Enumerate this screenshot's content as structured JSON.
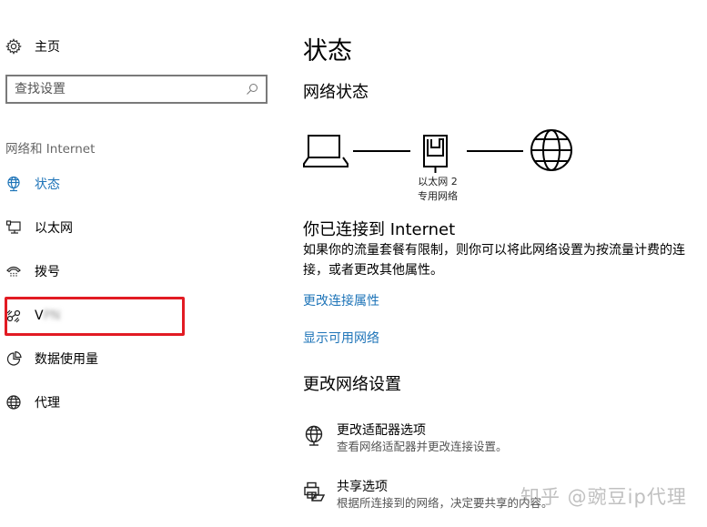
{
  "sidebar": {
    "home_label": "主页",
    "search_placeholder": "查找设置",
    "section_header": "网络和 Internet",
    "items": [
      {
        "label": "状态",
        "icon": "globe-monitor-icon",
        "active": true
      },
      {
        "label": "以太网",
        "icon": "ethernet-monitor-icon",
        "active": false
      },
      {
        "label": "拨号",
        "icon": "dialup-phone-icon",
        "active": false
      },
      {
        "label": "V",
        "label_blurred": "PN",
        "icon": "vpn-icon",
        "active": false,
        "highlighted": true
      },
      {
        "label": "数据使用量",
        "icon": "data-usage-pie-icon",
        "active": false
      },
      {
        "label": "代理",
        "icon": "globe-icon",
        "active": false
      }
    ]
  },
  "main": {
    "title": "状态",
    "network_status_heading": "网络状态",
    "diagram": {
      "adapter_name": "以太网 2",
      "network_type": "专用网络"
    },
    "connected_heading": "你已连接到 Internet",
    "connected_description": "如果你的流量套餐有限制，则你可以将此网络设置为按流量计费的连接，或者更改其他属性。",
    "links": [
      {
        "label": "更改连接属性"
      },
      {
        "label": "显示可用网络"
      }
    ],
    "change_settings_heading": "更改网络设置",
    "options": [
      {
        "title": "更改适配器选项",
        "description": "查看网络适配器并更改连接设置。",
        "icon": "adapter-globe-icon"
      },
      {
        "title": "共享选项",
        "description": "根据所连接到的网络，决定要共享的内容。",
        "icon": "sharing-printer-folder-icon"
      }
    ]
  },
  "watermark": "知乎 @豌豆ip代理",
  "colors": {
    "accent": "#1e74b8",
    "highlight_box": "#e21b23",
    "search_border": "#7a7a7a"
  }
}
